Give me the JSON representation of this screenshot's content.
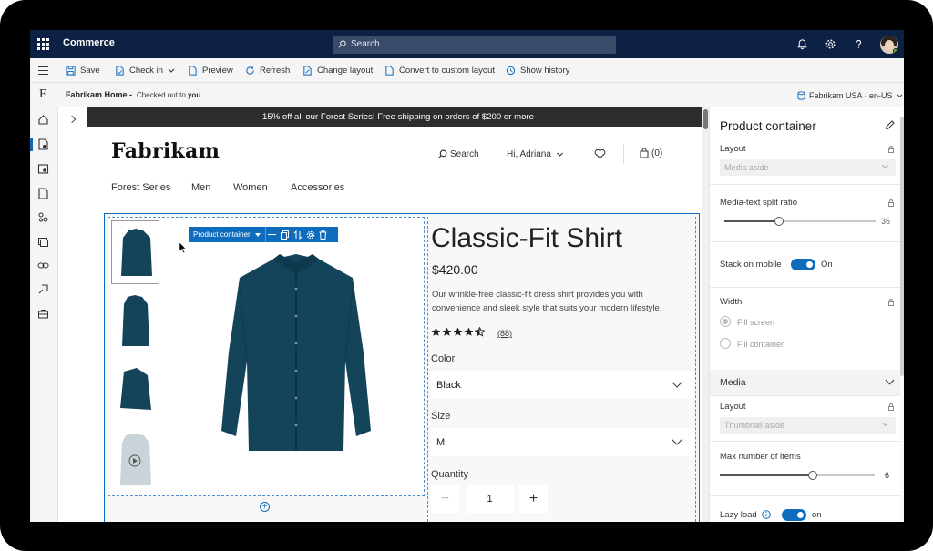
{
  "app": {
    "name": "Commerce",
    "search_placeholder": "Search"
  },
  "toolbar": {
    "save": "Save",
    "check_in": "Check in",
    "preview": "Preview",
    "refresh": "Refresh",
    "change_layout": "Change layout",
    "convert": "Convert to custom layout",
    "history": "Show history"
  },
  "breadcrumb": {
    "logo_letter": "F",
    "page": "Fabrikam Home -",
    "status_prefix": "Checked out to",
    "status_user": "you",
    "locale": "Fabrikam USA · en-US"
  },
  "site": {
    "promo": "15% off all our Forest Series! Free shipping on orders of $200 or more",
    "logo": "Fabrikam",
    "search": "Search",
    "greeting": "Hi, Adriana",
    "cart": "(0)",
    "nav": [
      "Forest Series",
      "Men",
      "Women",
      "Accessories"
    ]
  },
  "editor_toolbar": {
    "label": "Product container"
  },
  "product": {
    "title": "Classic-Fit Shirt",
    "price": "$420.00",
    "description": "Our wrinkle-free classic-fit dress shirt provides you with convenience and sleek style that suits your modern lifestyle.",
    "rating": 4.5,
    "reviews": "(88)",
    "color_label": "Color",
    "color_value": "Black",
    "size_label": "Size",
    "size_value": "M",
    "quantity_label": "Quantity",
    "quantity": "1",
    "shirt_color": "#13445a"
  },
  "panel": {
    "title": "Product container",
    "layout_label": "Layout",
    "layout_value": "Media aside",
    "split_label": "Media-text split ratio",
    "split_value": "36",
    "split_fraction": 0.36,
    "stack_label": "Stack on mobile",
    "stack_state": "On",
    "width_label": "Width",
    "width_options": [
      "Fill screen",
      "Fill container"
    ],
    "media_header": "Media",
    "media_layout_label": "Layout",
    "media_layout_value": "Thumbnail aside",
    "max_items_label": "Max number of items",
    "max_items_value": "6",
    "max_items_fraction": 0.6,
    "lazy_label": "Lazy load",
    "lazy_state": "on"
  },
  "colors": {
    "accent": "#0f6cbd",
    "topbar": "#0d2145"
  }
}
